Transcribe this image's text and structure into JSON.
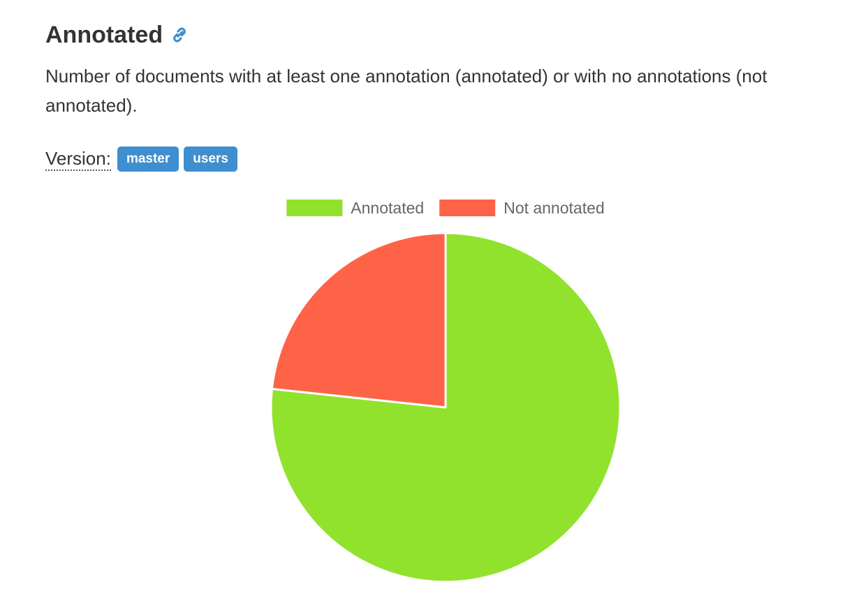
{
  "header": {
    "title": "Annotated",
    "link_icon": "link-icon",
    "description": "Number of documents with at least one annotation (annotated) or with no annotations (not annotated)."
  },
  "version": {
    "label": "Version:",
    "badges": [
      "master",
      "users"
    ],
    "badge_color": "#3e8ed0"
  },
  "chart_data": {
    "type": "pie",
    "title": "",
    "labels": [
      "Annotated",
      "Not annotated"
    ],
    "values": [
      76.7,
      23.3
    ],
    "colors": [
      "#91e22c",
      "#ff6347"
    ],
    "legend_position": "top"
  }
}
